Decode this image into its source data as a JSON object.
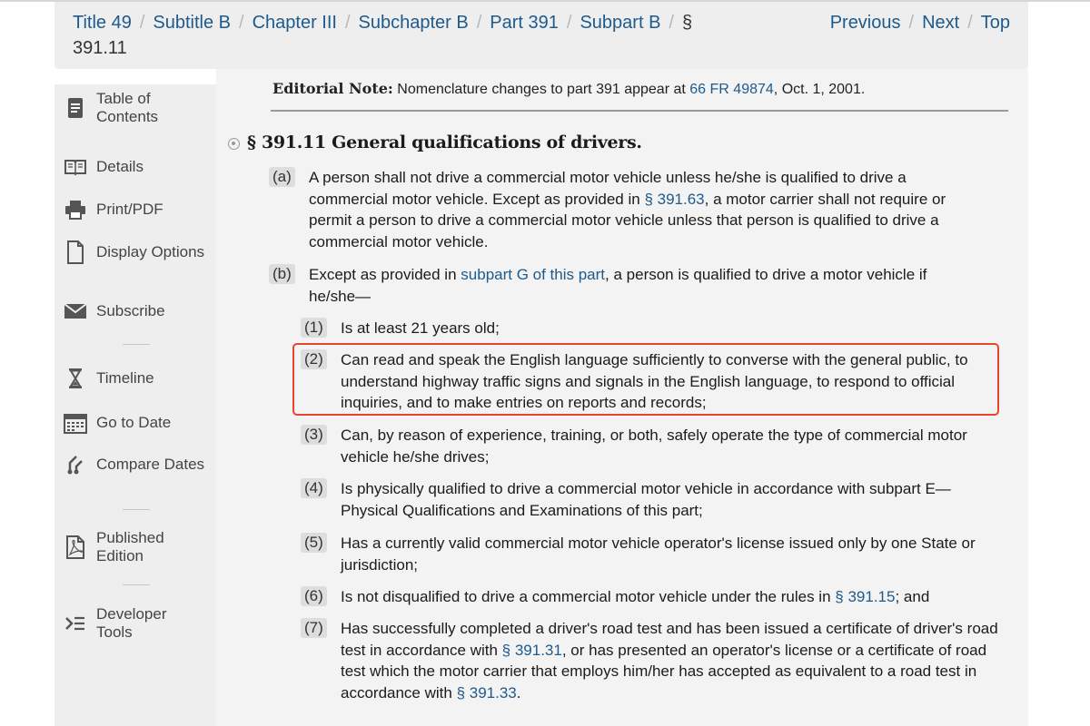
{
  "breadcrumb": {
    "title": "Title 49",
    "subtitle": "Subtitle B",
    "chapter": "Chapter III",
    "subchapter": "Subchapter B",
    "part": "Part 391",
    "subpart": "Subpart B",
    "section_symbol": "§",
    "current": "391.11"
  },
  "nav": {
    "previous": "Previous",
    "next": "Next",
    "top": "Top"
  },
  "sidebar": {
    "items": [
      {
        "label": "Table of Contents",
        "icon": "table-of-contents-icon"
      },
      {
        "label": "Details",
        "icon": "book-open-icon"
      },
      {
        "label": "Print/PDF",
        "icon": "printer-icon"
      },
      {
        "label": "Display Options",
        "icon": "document-icon"
      },
      {
        "label": "Subscribe",
        "icon": "envelope-icon"
      },
      {
        "label": "Timeline",
        "icon": "hourglass-icon"
      },
      {
        "label": "Go to Date",
        "icon": "calendar-icon"
      },
      {
        "label": "Compare Dates",
        "icon": "compare-icon"
      },
      {
        "label": "Published Edition",
        "icon": "pdf-file-icon"
      },
      {
        "label": "Developer Tools",
        "icon": "terminal-icon"
      }
    ]
  },
  "editorial": {
    "label": "Editorial Note:",
    "text": "Nomenclature changes to part 391 appear at",
    "link": "66 FR 49874",
    "tail": ", Oct. 1, 2001."
  },
  "section": {
    "title": "§ 391.11 General qualifications of drivers.",
    "a": {
      "num": "(a)",
      "pre": "A person shall not drive a commercial motor vehicle unless he/she is qualified to drive a commercial motor vehicle. Except as provided in",
      "link": "§ 391.63",
      "post": ", a motor carrier shall not require or permit a person to drive a commercial motor vehicle unless that person is qualified to drive a commercial motor vehicle."
    },
    "b": {
      "num": "(b)",
      "pre": "Except as provided in",
      "link": "subpart G of this part",
      "post": ", a person is qualified to drive a motor vehicle if he/she—"
    },
    "items": [
      {
        "num": "(1)",
        "text": "Is at least 21 years old;"
      },
      {
        "num": "(2)",
        "text": "Can read and speak the English language sufficiently to converse with the general public, to understand highway traffic signs and signals in the English language, to respond to official inquiries, and to make entries on reports and records;"
      },
      {
        "num": "(3)",
        "text": "Can, by reason of experience, training, or both, safely operate the type of commercial motor vehicle he/she drives;"
      },
      {
        "num": "(4)",
        "text": "Is physically qualified to drive a commercial motor vehicle in accordance with subpart E—Physical Qualifications and Examinations of this part;"
      },
      {
        "num": "(5)",
        "text": "Has a currently valid commercial motor vehicle operator's license issued only by one State or jurisdiction;"
      },
      {
        "num": "(6)",
        "pre": "Is not disqualified to drive a commercial motor vehicle under the rules in",
        "link": "§ 391.15",
        "post": "; and"
      },
      {
        "num": "(7)",
        "pre": "Has successfully completed a driver's road test and has been issued a certificate of driver's road test in accordance with",
        "link": "§ 391.31",
        "mid": ", or has presented an operator's license or a certificate of road test which the motor carrier that employs him/her has accepted as equivalent to a road test in accordance with",
        "link2": "§ 391.33",
        "post": "."
      }
    ]
  },
  "colors": {
    "link": "#1e5a8c",
    "highlight_border": "#e8462a",
    "sidebar_bg": "#eeeeee"
  }
}
